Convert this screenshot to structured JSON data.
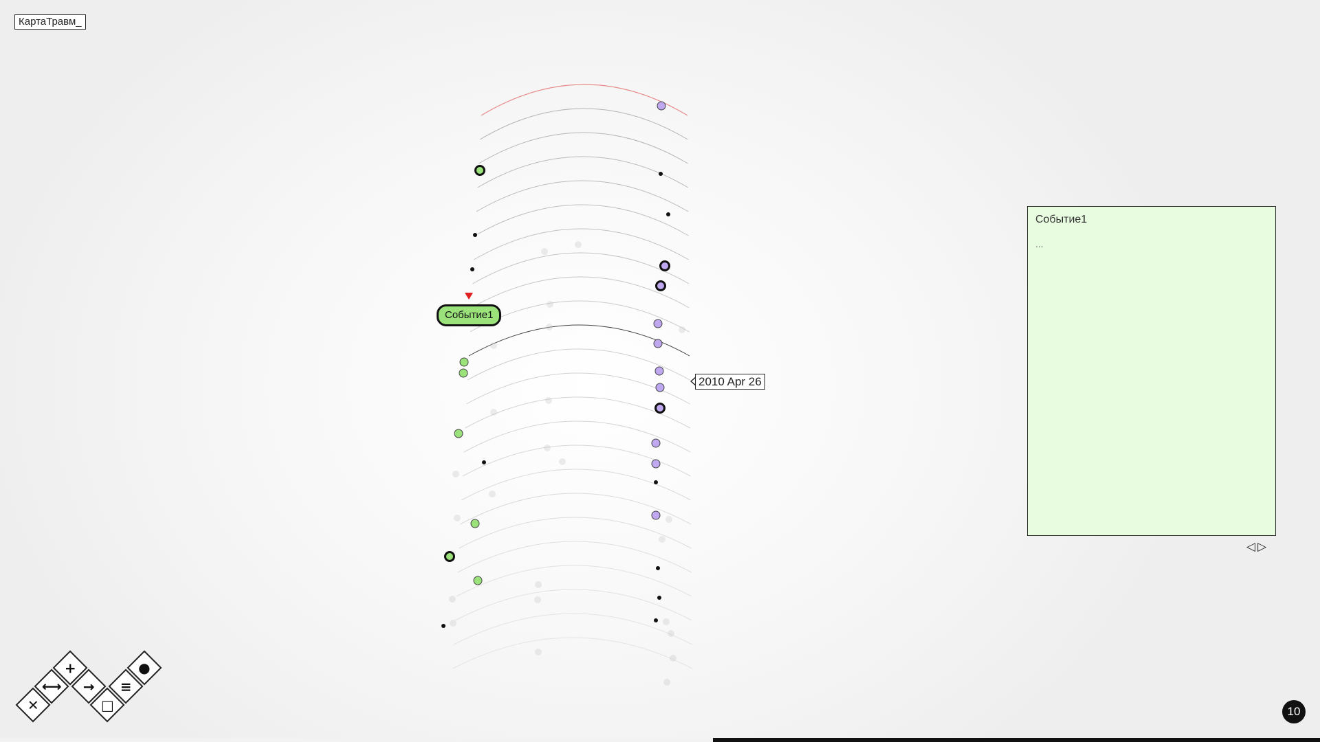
{
  "app": {
    "title": "КартаТравм_"
  },
  "timeline": {
    "event_label": "Событие1",
    "date_label": "2010 Apr 26",
    "colors": {
      "green_marker": "#9be27a",
      "purple_marker": "#bfa8f0",
      "top_ring": "#e88a8a",
      "event_pointer": "#e02020"
    }
  },
  "panel": {
    "title": "Событие1",
    "body": "..."
  },
  "pager": {
    "prev_icon": "◁",
    "next_icon": "▷"
  },
  "page_number": "10",
  "progress": {
    "fraction": 0.46
  },
  "toolbar": {
    "tools": [
      {
        "name": "delete-tool-button",
        "icon": "✕",
        "icon_name": "close-icon"
      },
      {
        "name": "connect-tool-button",
        "icon": "⟷",
        "icon_name": "link-icon"
      },
      {
        "name": "add-tool-button",
        "icon": "+",
        "icon_name": "plus-icon"
      },
      {
        "name": "arrow-tool-button",
        "icon": "→",
        "icon_name": "arrow-right-icon"
      },
      {
        "name": "box-tool-button",
        "icon": "□",
        "icon_name": "square-icon"
      },
      {
        "name": "lines-tool-button",
        "icon": "≡",
        "icon_name": "lines-icon"
      },
      {
        "name": "color-tool-button",
        "icon": "●",
        "icon_name": "drop-icon"
      }
    ]
  }
}
